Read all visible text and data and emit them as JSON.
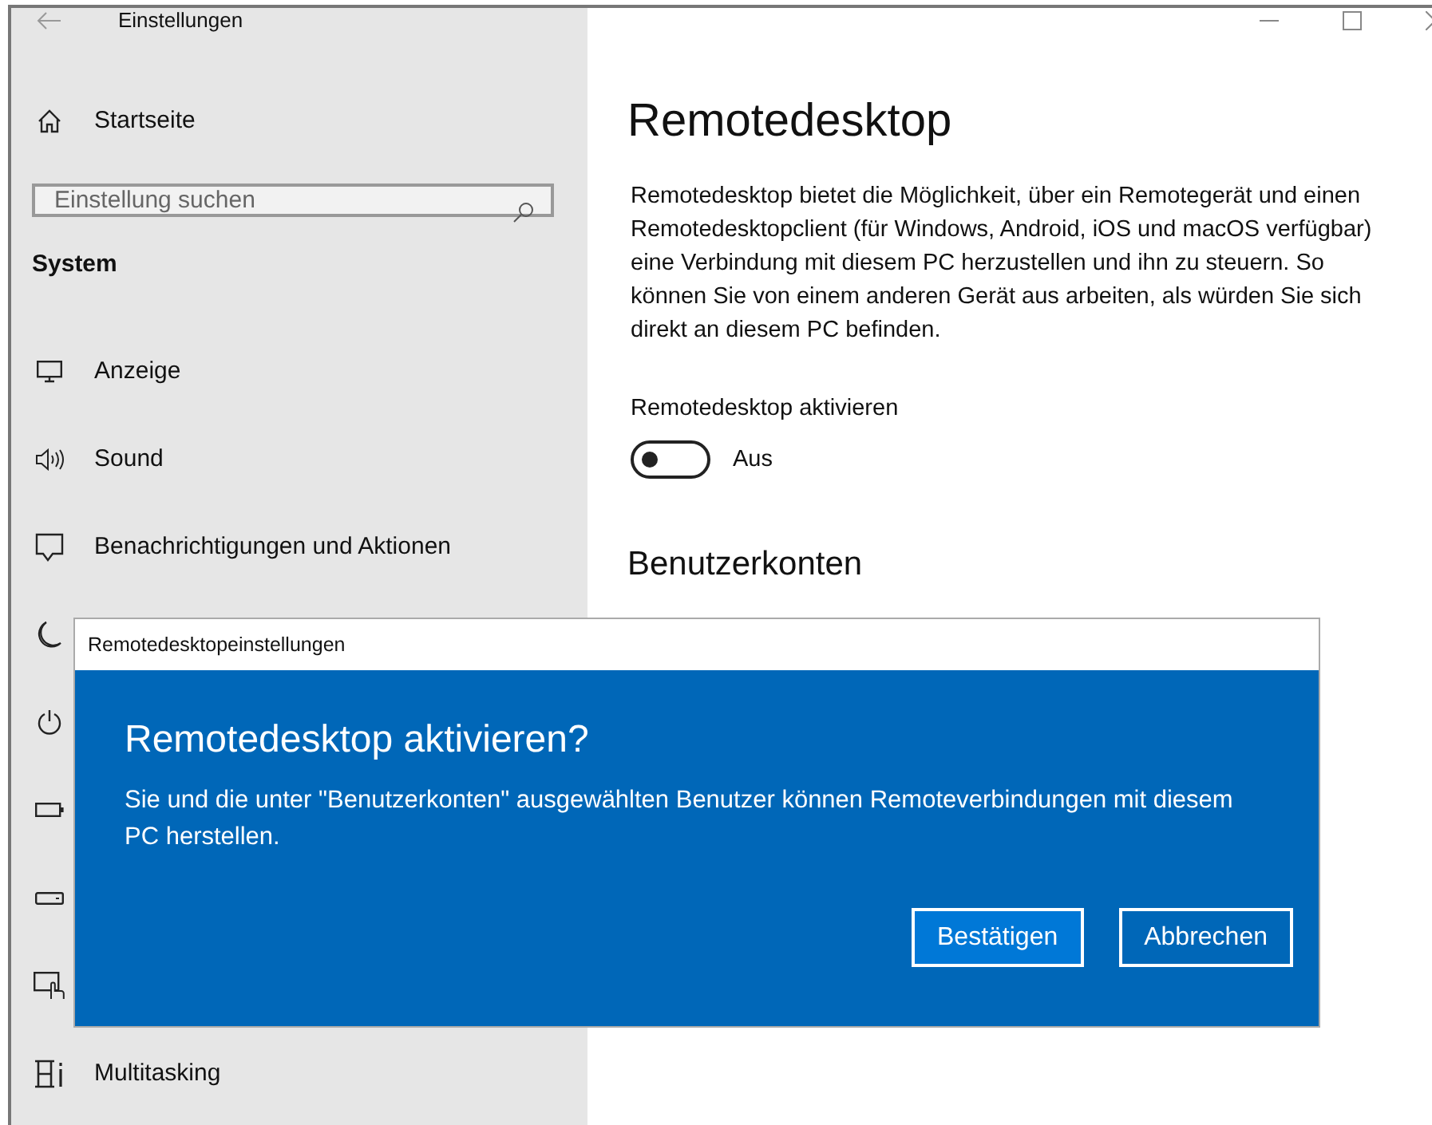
{
  "window": {
    "title": "Einstellungen"
  },
  "sidebar": {
    "home": "Startseite",
    "search": {
      "placeholder": "Einstellung suchen"
    },
    "section": "System",
    "items": [
      {
        "kind": "display",
        "label": "Anzeige"
      },
      {
        "kind": "sound",
        "label": "Sound"
      },
      {
        "kind": "notifications",
        "label": "Benachrichtigungen und Aktionen"
      },
      {
        "kind": "moon"
      },
      {
        "kind": "power"
      },
      {
        "kind": "battery"
      },
      {
        "kind": "storage"
      },
      {
        "kind": "tablet"
      },
      {
        "kind": "multitasking",
        "label": "Multitasking"
      }
    ]
  },
  "main": {
    "title": "Remotedesktop",
    "description": "Remotedesktop bietet die Möglichkeit, über ein Remotegerät und einen Remotedesktopclient (für Windows, Android, iOS und macOS verfügbar) eine Verbindung mit diesem PC herzustellen und ihn zu steuern. So können Sie von einem anderen Gerät aus arbeiten, als würden Sie sich direkt an diesem PC befinden.",
    "toggle": {
      "label": "Remotedesktop aktivieren",
      "on": false,
      "state_text": "Aus"
    },
    "section": "Benutzerkonten"
  },
  "dialog": {
    "title": "Remotedesktopeinstellungen",
    "heading": "Remotedesktop aktivieren?",
    "message": "Sie und die unter \"Benutzerkonten\" ausgewählten Benutzer können Remoteverbindungen mit diesem PC herstellen.",
    "buttons": [
      {
        "label": "Bestätigen",
        "selected": true
      },
      {
        "label": "Abbrechen",
        "selected": false
      }
    ]
  }
}
